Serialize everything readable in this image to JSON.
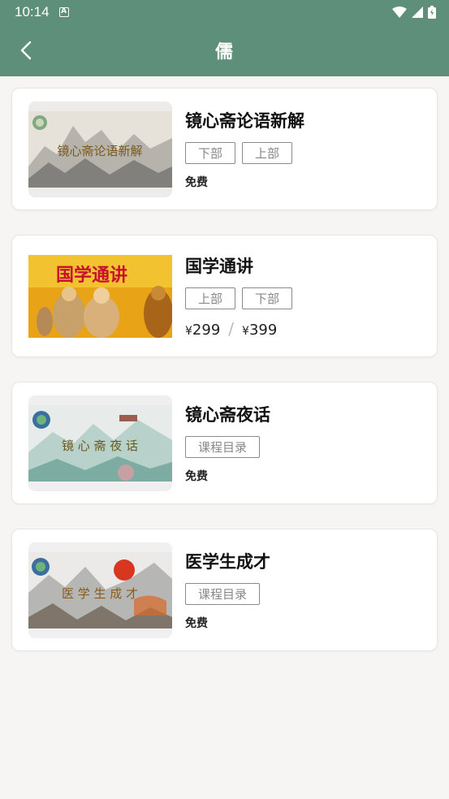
{
  "status": {
    "time": "10:14",
    "badge": "A"
  },
  "header": {
    "title": "儒"
  },
  "courses": [
    {
      "title": "镜心斋论语新解",
      "thumb_text": "镜心斋论语新解",
      "chips": [
        "下部",
        "上部"
      ],
      "price": "免费"
    },
    {
      "title": "国学通讲",
      "thumb_text": "国学通讲",
      "chips": [
        "上部",
        "下部"
      ],
      "price_a": "299",
      "price_b": "399",
      "currency": "¥",
      "price_sep": "/"
    },
    {
      "title": "镜心斋夜话",
      "thumb_text": "镜 心 斋 夜 话",
      "chips": [
        "课程目录"
      ],
      "price": "免费"
    },
    {
      "title": "医学生成才",
      "thumb_text": "医 学 生 成 才",
      "chips": [
        "课程目录"
      ],
      "price": "免费"
    }
  ],
  "colors": {
    "header": "#5e8f7b",
    "background": "#f6f5f3"
  }
}
